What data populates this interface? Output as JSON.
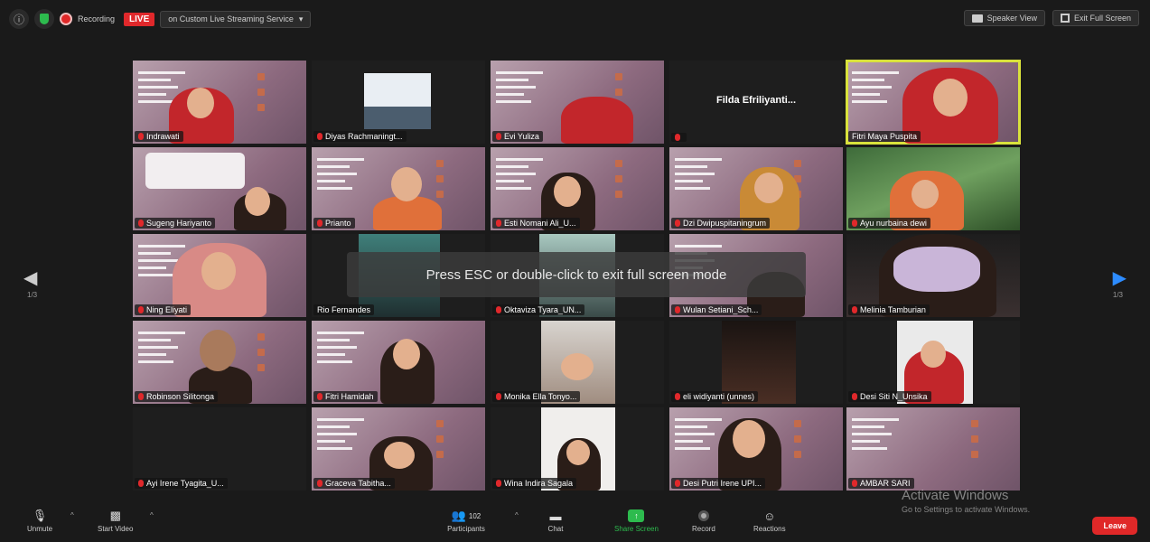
{
  "topbar": {
    "recording_label": "Recording",
    "live_badge": "LIVE",
    "streaming_service": "on Custom Live Streaming Service",
    "speaker_view": "Speaker View",
    "exit_full_screen": "Exit Full Screen"
  },
  "overlay_message": "Press ESC or double-click to exit full screen mode",
  "pagination": {
    "left": "1/3",
    "right": "1/3"
  },
  "participants": [
    "Indrawati",
    "Diyas Rachmaningt...",
    "Evi Yuliza",
    "",
    "Fitri Maya Puspita",
    "Sugeng Hariyanto",
    "Prianto",
    "Esti Nomani Ali_U...",
    "Dzi Dwipuspitaningrum",
    "Ayu nurbaina dewi",
    "Ning Eliyati",
    "Rio Fernandes",
    "Oktaviza Tyara_UN...",
    "Wulan Setiani_Sch...",
    "Melinia Tamburian",
    "Robinson Silitonga",
    "Fitri Hamidah",
    "Monika Ella Tonyo...",
    "eli widiyanti (unnes)",
    "Desi Siti N_Unsika",
    "Ayi Irene Tyagita_U...",
    "Graceva Tabitha...",
    "Wina Indira Sagala",
    "Desi Putri Irene UPI...",
    "AMBAR SARI"
  ],
  "center_name": "Filda Efriliyanti...",
  "bottombar": {
    "unmute": "Unmute",
    "start_video": "Start Video",
    "participants": "Participants",
    "participant_count": "102",
    "chat": "Chat",
    "share_screen": "Share Screen",
    "record": "Record",
    "reactions": "Reactions",
    "leave": "Leave"
  },
  "watermark": {
    "line1": "Activate Windows",
    "line2": "Go to Settings to activate Windows."
  },
  "colors": {
    "live_red": "#e0282b",
    "share_green": "#2dbb4e",
    "active_outline": "#d9e23c",
    "next_arrow": "#2d8cff"
  }
}
